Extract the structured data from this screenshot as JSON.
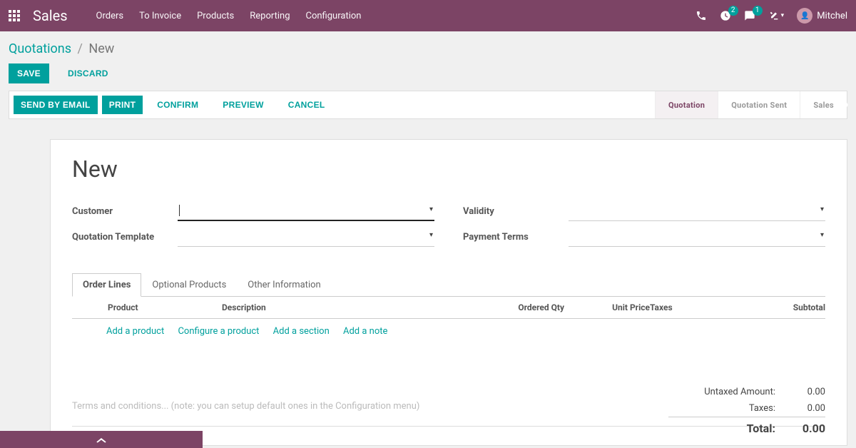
{
  "topnav": {
    "brand": "Sales",
    "menu": [
      "Orders",
      "To Invoice",
      "Products",
      "Reporting",
      "Configuration"
    ],
    "badges": {
      "activities": "2",
      "discuss": "1"
    },
    "user": "Mitchel"
  },
  "breadcrumb": {
    "root": "Quotations",
    "current": "New"
  },
  "buttons": {
    "save": "Save",
    "discard": "Discard",
    "send_by_email": "Send by Email",
    "print": "Print",
    "confirm": "Confirm",
    "preview": "Preview",
    "cancel": "Cancel"
  },
  "stages": {
    "quotation": "Quotation",
    "quotation_sent": "Quotation Sent",
    "sales": "Sales"
  },
  "form": {
    "title": "New",
    "labels": {
      "customer": "Customer",
      "quotation_template": "Quotation Template",
      "validity": "Validity",
      "payment_terms": "Payment Terms"
    },
    "tabs": [
      "Order Lines",
      "Optional Products",
      "Other Information"
    ],
    "columns": {
      "product": "Product",
      "description": "Description",
      "ordered_qty": "Ordered Qty",
      "unit_price": "Unit Price",
      "taxes": "Taxes",
      "subtotal": "Subtotal"
    },
    "line_actions": {
      "add_product": "Add a product",
      "configure_product": "Configure a product",
      "add_section": "Add a section",
      "add_note": "Add a note"
    },
    "terms_placeholder": "Terms and conditions... (note: you can setup default ones in the Configuration menu)",
    "totals": {
      "untaxed_label": "Untaxed Amount:",
      "untaxed_value": "0.00",
      "taxes_label": "Taxes:",
      "taxes_value": "0.00",
      "total_label": "Total:",
      "total_value": "0.00"
    }
  }
}
